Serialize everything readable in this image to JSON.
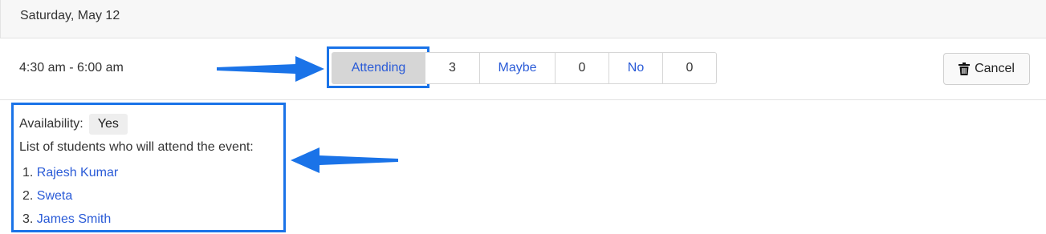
{
  "date_header": "Saturday, May 12",
  "event": {
    "time_range": "4:30 am - 6:00 am",
    "rsvp": {
      "attending_label": "Attending",
      "attending_count": "3",
      "maybe_label": "Maybe",
      "maybe_count": "0",
      "no_label": "No",
      "no_count": "0",
      "selected": "Attending"
    },
    "cancel_label": "Cancel",
    "cancel_icon": "trash-icon"
  },
  "details": {
    "availability_label": "Availability:",
    "availability_value": "Yes",
    "students_title": "List of students who will attend the event:",
    "students": [
      {
        "number": "1.",
        "name": "Rajesh Kumar"
      },
      {
        "number": "2.",
        "name": "Sweta"
      },
      {
        "number": "3.",
        "name": "James Smith"
      }
    ]
  },
  "colors": {
    "highlight": "#1a73e8",
    "link": "#2a5bd7",
    "active_button": "#d6d6d6"
  }
}
